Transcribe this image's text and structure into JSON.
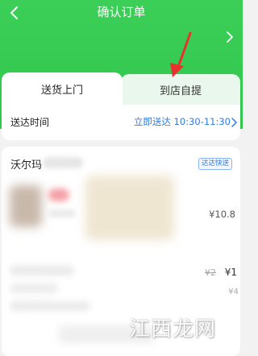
{
  "header": {
    "title": "确认订单"
  },
  "tabs": [
    {
      "label": "送货上门",
      "active": true
    },
    {
      "label": "到店自提",
      "active": false
    }
  ],
  "delivery": {
    "label": "送达时间",
    "value": "立即送达 10:30-11:30"
  },
  "store": {
    "name": "沃尔玛",
    "badge": "达达快送"
  },
  "product": {
    "price": "¥10.8"
  },
  "prices": {
    "original": "¥2",
    "current": "¥1",
    "partial": "¥4"
  },
  "watermark": {
    "text": "江西龙网"
  },
  "colors": {
    "header_green": "#3ccf58",
    "link_blue": "#2f7be6",
    "arrow_red": "#e8322d"
  }
}
